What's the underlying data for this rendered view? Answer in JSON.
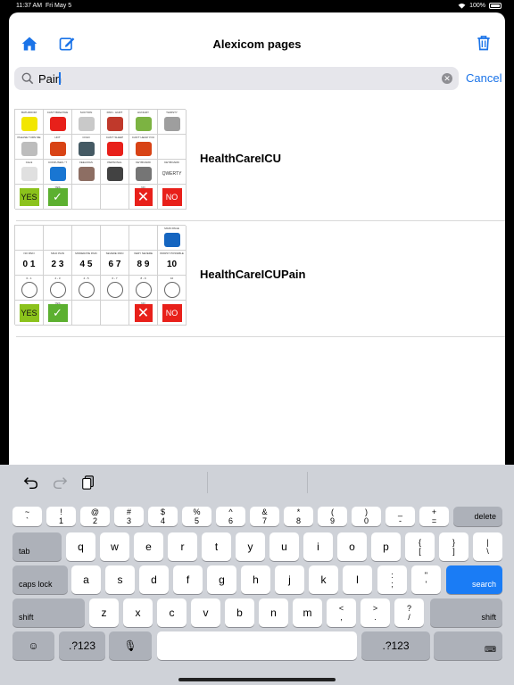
{
  "status": {
    "time": "11:37 AM",
    "date": "Fri May 5",
    "battery": "100%"
  },
  "nav": {
    "title": "Alexicom pages"
  },
  "search": {
    "value": "Pain",
    "cancel": "Cancel"
  },
  "results": [
    {
      "title": "HealthCareICU",
      "cells": [
        {
          "cap": "BATHROOM",
          "kind": "pic",
          "color": "#f2e600"
        },
        {
          "cap": "CAN'T BREATHE",
          "kind": "pic",
          "color": "#e8201a"
        },
        {
          "cap": "SUCTION",
          "kind": "pic",
          "color": "#c9c9c9"
        },
        {
          "cap": "PAIN - HURT",
          "kind": "pic",
          "color": "#c0392b"
        },
        {
          "cap": "HUNGRY",
          "kind": "pic",
          "color": "#7cb342"
        },
        {
          "cap": "THIRSTY",
          "kind": "pic",
          "color": "#9e9e9e"
        },
        {
          "cap": "PLEASE TURN ME",
          "kind": "pic",
          "color": "#bdbdbd"
        },
        {
          "cap": "HOT",
          "kind": "pic",
          "color": "#d84315"
        },
        {
          "cap": "COLD",
          "kind": "pic",
          "color": "#455a64"
        },
        {
          "cap": "CAN'T SLEEP",
          "kind": "pic",
          "color": "#e8201a"
        },
        {
          "cap": "CAN'T HEAR YOU",
          "kind": "pic",
          "color": "#d84315"
        },
        {
          "cap": "",
          "kind": "empty"
        },
        {
          "cap": "Clock",
          "kind": "pic",
          "color": "#e0e0e0"
        },
        {
          "cap": "CONFUSED / ?",
          "kind": "pic",
          "color": "#1976d2"
        },
        {
          "cap": "FEELINGS",
          "kind": "pic",
          "color": "#8d6e63"
        },
        {
          "cap": "PERSONAL",
          "kind": "pic",
          "color": "#424242"
        },
        {
          "cap": "KEYBOARD",
          "kind": "pic",
          "color": "#757575"
        },
        {
          "cap": "KEYBOARD",
          "kind": "text",
          "text": "QWERTY"
        },
        {
          "cap": "",
          "kind": "yes",
          "text": "YES"
        },
        {
          "cap": "YES",
          "kind": "check"
        },
        {
          "cap": "",
          "kind": "empty"
        },
        {
          "cap": "",
          "kind": "empty"
        },
        {
          "cap": "NO",
          "kind": "x"
        },
        {
          "cap": "",
          "kind": "no",
          "text": "NO"
        }
      ]
    },
    {
      "title": "HealthCareICUPain",
      "cells": [
        {
          "cap": "",
          "kind": "empty"
        },
        {
          "cap": "",
          "kind": "empty"
        },
        {
          "cap": "",
          "kind": "empty"
        },
        {
          "cap": "",
          "kind": "empty"
        },
        {
          "cap": "",
          "kind": "empty"
        },
        {
          "cap": "MAIN PAGE",
          "kind": "pic",
          "color": "#1565c0"
        },
        {
          "cap": "NO PAIN",
          "kind": "num",
          "text": "0 1"
        },
        {
          "cap": "MILD PAIN",
          "kind": "num",
          "text": "2 3"
        },
        {
          "cap": "MODERATE PAIN",
          "kind": "num",
          "text": "4 5"
        },
        {
          "cap": "SEVERE PAIN",
          "kind": "num",
          "text": "6 7"
        },
        {
          "cap": "VERY SEVERE",
          "kind": "num",
          "text": "8 9"
        },
        {
          "cap": "WORST POSSIBLE",
          "kind": "num",
          "text": "10"
        },
        {
          "cap": "0 - 1",
          "kind": "face"
        },
        {
          "cap": "2 - 3",
          "kind": "face"
        },
        {
          "cap": "4 - 5",
          "kind": "face"
        },
        {
          "cap": "6 - 7",
          "kind": "face"
        },
        {
          "cap": "8 - 9",
          "kind": "face"
        },
        {
          "cap": "10",
          "kind": "face"
        },
        {
          "cap": "",
          "kind": "yes",
          "text": "YES"
        },
        {
          "cap": "YES",
          "kind": "check"
        },
        {
          "cap": "",
          "kind": "empty"
        },
        {
          "cap": "",
          "kind": "empty"
        },
        {
          "cap": "NO",
          "kind": "x"
        },
        {
          "cap": "",
          "kind": "no",
          "text": "NO"
        }
      ]
    }
  ],
  "keyboard": {
    "row1": [
      {
        "top": "~",
        "bot": "`"
      },
      {
        "top": "!",
        "bot": "1"
      },
      {
        "top": "@",
        "bot": "2"
      },
      {
        "top": "#",
        "bot": "3"
      },
      {
        "top": "$",
        "bot": "4"
      },
      {
        "top": "%",
        "bot": "5"
      },
      {
        "top": "^",
        "bot": "6"
      },
      {
        "top": "&",
        "bot": "7"
      },
      {
        "top": "*",
        "bot": "8"
      },
      {
        "top": "(",
        "bot": "9"
      },
      {
        "top": ")",
        "bot": "0"
      },
      {
        "top": "_",
        "bot": "-"
      },
      {
        "top": "+",
        "bot": "="
      }
    ],
    "delete": "delete",
    "tab": "tab",
    "row2": [
      "q",
      "w",
      "e",
      "r",
      "t",
      "y",
      "u",
      "i",
      "o",
      "p"
    ],
    "row2_sym": [
      {
        "top": "{",
        "bot": "["
      },
      {
        "top": "}",
        "bot": "]"
      },
      {
        "top": "|",
        "bot": "\\"
      }
    ],
    "caps": "caps lock",
    "row3": [
      "a",
      "s",
      "d",
      "f",
      "g",
      "h",
      "j",
      "k",
      "l"
    ],
    "row3_sym": [
      {
        "top": ":",
        "bot": ";"
      },
      {
        "top": "\"",
        "bot": "'"
      }
    ],
    "search": "search",
    "shift": "shift",
    "row4": [
      "z",
      "x",
      "c",
      "v",
      "b",
      "n",
      "m"
    ],
    "row4_sym": [
      {
        "top": "<",
        "bot": ","
      },
      {
        "top": ">",
        "bot": "."
      },
      {
        "top": "?",
        "bot": "/"
      }
    ],
    "num_left": ".?123",
    "num_right": ".?123",
    "emoji": "☺",
    "mic": "🎙",
    "hide": "⌨"
  }
}
